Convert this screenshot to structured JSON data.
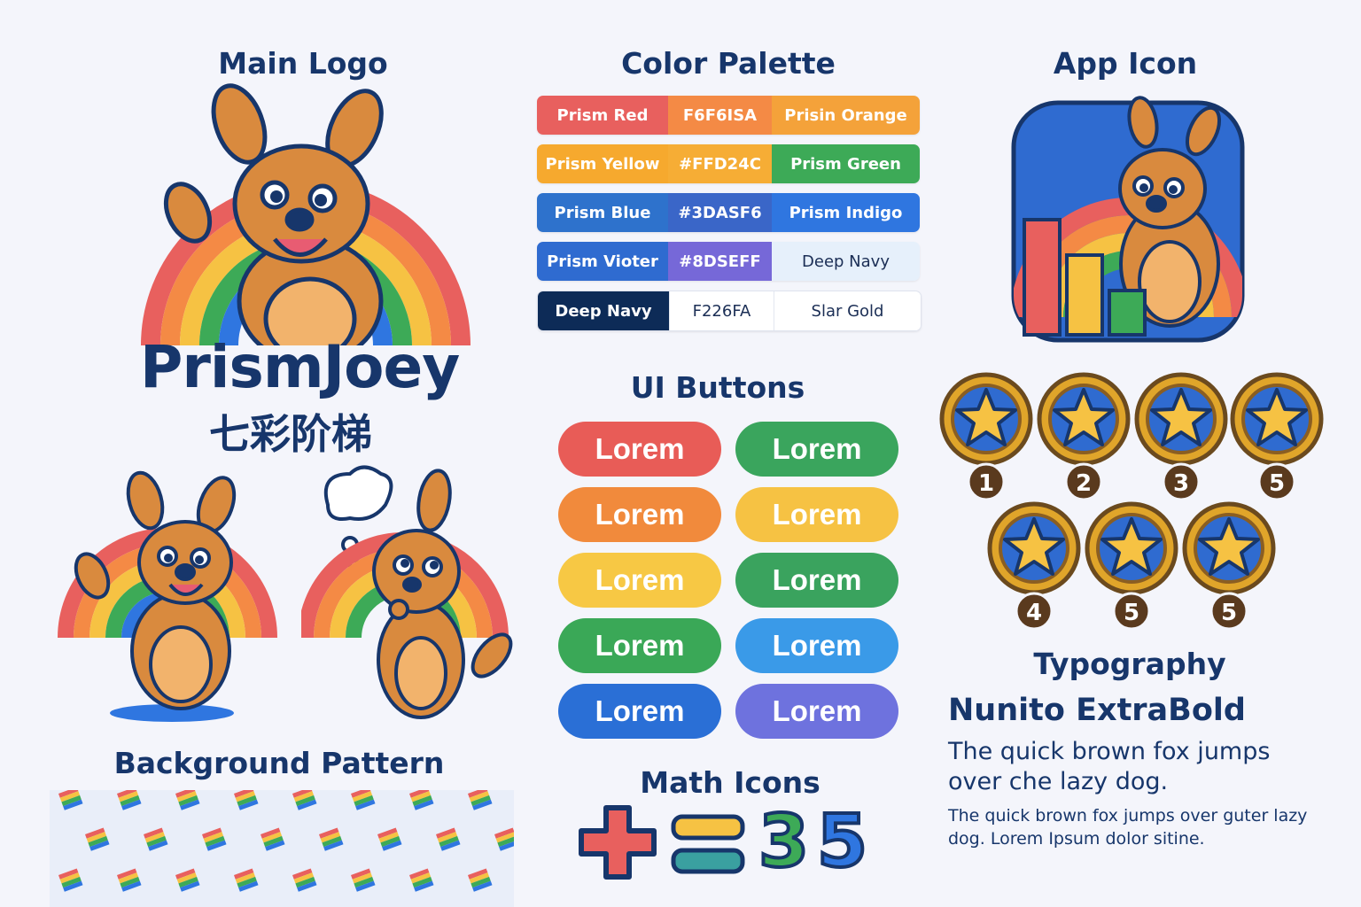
{
  "sections": {
    "main_logo": "Main Logo",
    "color_palette": "Color Palette",
    "app_icon": "App Icon",
    "ui_buttons": "UI Buttons",
    "background_pattern": "Background Pattern",
    "math_icons": "Math Icons",
    "typography": "Typography"
  },
  "logo": {
    "name": "PrismJoey",
    "subtitle": "七彩阶梯"
  },
  "palette": [
    {
      "cells": [
        {
          "label": "Prism Red",
          "color": "#e8605e"
        },
        {
          "label": "F6F6ISA",
          "color": "#f48a45"
        },
        {
          "label": "Prisin Orange",
          "color": "#f4a23a"
        }
      ]
    },
    {
      "cells": [
        {
          "label": "Prism Yellow",
          "color": "#f6a92e"
        },
        {
          "label": "#FFD24C",
          "color": "#f6ad35"
        },
        {
          "label": "Prism Green",
          "color": "#3daa57"
        }
      ]
    },
    {
      "cells": [
        {
          "label": "Prism Blue",
          "color": "#2e72cc"
        },
        {
          "label": "#3DASF6",
          "color": "#3a66c8"
        },
        {
          "label": "Prism Indigo",
          "color": "#2f76e0"
        }
      ]
    },
    {
      "cells": [
        {
          "label": "Prism Vioter",
          "color": "#2f6bd0"
        },
        {
          "label": "#8DSEFF",
          "color": "#7668d8"
        },
        {
          "label": "Deep Navy",
          "color": "#e6f0fb"
        }
      ]
    },
    {
      "cells": [
        {
          "label": "Deep Navy",
          "color": "#0d2b57"
        },
        {
          "label": "F226FA",
          "color": "#ffffff"
        },
        {
          "label": "Slar Gold",
          "color": "#ffffff"
        }
      ]
    }
  ],
  "buttons": [
    {
      "label": "Lorem",
      "color": "#e85c57"
    },
    {
      "label": "Lorem",
      "color": "#3aa55d"
    },
    {
      "label": "Lorem",
      "color": "#f18a3c"
    },
    {
      "label": "Lorem",
      "color": "#f6c243"
    },
    {
      "label": "Lorem",
      "color": "#f7c844"
    },
    {
      "label": "Lorem",
      "color": "#3aa35e"
    },
    {
      "label": "Lorem",
      "color": "#3aa857"
    },
    {
      "label": "Lorem",
      "color": "#3a9ae8"
    },
    {
      "label": "Lorem",
      "color": "#2a6fd6"
    },
    {
      "label": "Lorem",
      "color": "#6e72de"
    }
  ],
  "medals": [
    "1",
    "2",
    "3",
    "5",
    "4",
    "5",
    "5"
  ],
  "math_icons": {
    "digit1": "3",
    "digit2": "5"
  },
  "typography": {
    "font_name": "Nunito ExtraBold",
    "sample_large": "The quick brown fox jumps over che lazy dog.",
    "sample_small": "The quick brown fox jumps over guter lazy dog. Lorem Ipsum dolor sitine."
  },
  "colors": {
    "navy": "#17366b",
    "kangaroo": "#d98a3e",
    "belly": "#f2b36c"
  }
}
